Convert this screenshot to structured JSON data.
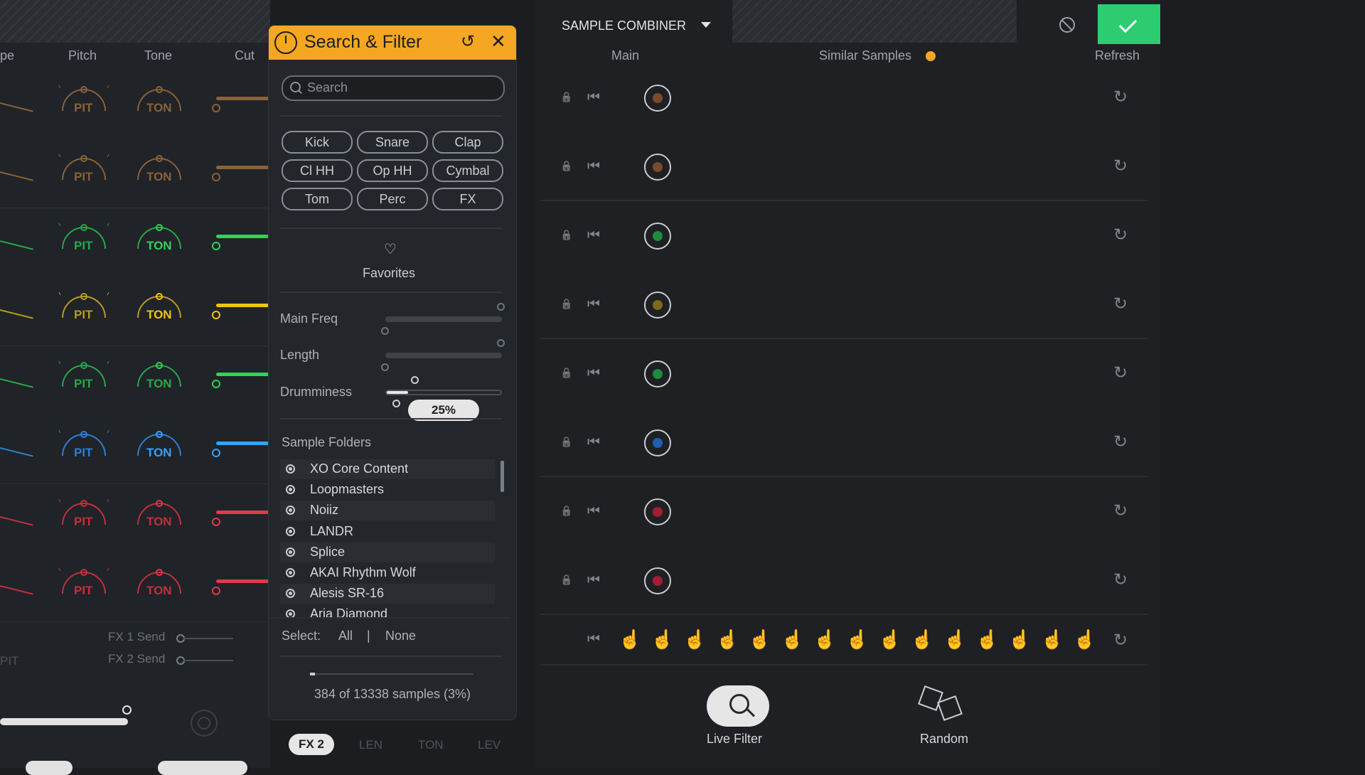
{
  "left_panel": {
    "columns": [
      "pe",
      "Pitch",
      "Tone",
      "Cut"
    ],
    "knob_labels": {
      "pitch": "PIT",
      "tone": "TON"
    },
    "row_colors": [
      "#8a6138",
      "#8a6138",
      "#27a74a",
      "#b89a25",
      "#27a74a",
      "#2b7fd1",
      "#c0303f",
      "#c0303f"
    ],
    "bright_colors": [
      "#8a6138",
      "#8a6138",
      "#2ed35a",
      "#f1c40f",
      "#2ed35a",
      "#36a3ff",
      "#e0394d",
      "#e0394d"
    ],
    "sends": [
      "FX 1 Send",
      "FX 2 Send"
    ],
    "bottom_pit": "PIT"
  },
  "popup": {
    "title": "Search & Filter",
    "search_placeholder": "Search",
    "tags": [
      "Kick",
      "Snare",
      "Clap",
      "Cl HH",
      "Op HH",
      "Cymbal",
      "Tom",
      "Perc",
      "FX"
    ],
    "favorites_label": "Favorites",
    "params": [
      {
        "label": "Main Freq"
      },
      {
        "label": "Length"
      },
      {
        "label": "Drumminess",
        "value": 25
      }
    ],
    "drumminess_tooltip": "25%",
    "folders_title": "Sample Folders",
    "folders": [
      "XO Core Content",
      "Loopmasters",
      "Noiiz",
      "LANDR",
      "Splice",
      "AKAI Rhythm Wolf",
      "Alesis SR-16",
      "Aria Diamond"
    ],
    "select_label": "Select:",
    "select_all": "All",
    "select_divider": "|",
    "select_none": "None",
    "status": "384 of 13338 samples (3%)",
    "progress_fraction": 0.03
  },
  "combiner": {
    "title": "SAMPLE COMBINER",
    "headers": {
      "main": "Main",
      "similar": "Similar Samples",
      "refresh": "Refresh"
    },
    "slot_colors": [
      "#7a4b2a",
      "#7a4b2a",
      "#1e8a3d",
      "#7c6a1c",
      "#1e8a3d",
      "#1f5fae",
      "#a01f32",
      "#a01f32"
    ],
    "live_filter_label": "Live Filter",
    "random_label": "Random"
  },
  "bottom": {
    "fx2": "FX 2",
    "fx_knobs": [
      "LEN",
      "TON",
      "LEV"
    ]
  }
}
